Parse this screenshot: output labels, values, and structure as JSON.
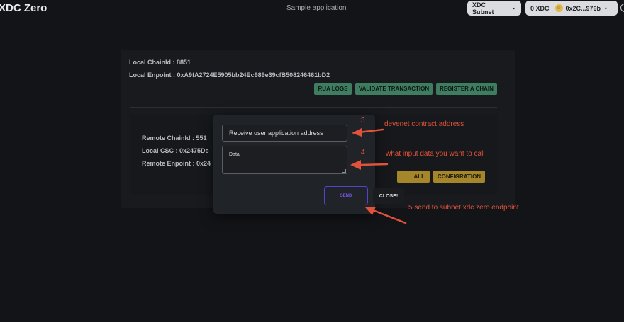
{
  "header": {
    "brand": "XDC Zero",
    "app_title": "Sample application",
    "network_button": "XDC Subnet",
    "balance": "0 XDC",
    "wallet_address": "0x2C...976b"
  },
  "local": {
    "chain_id": "Local ChainId : 8851",
    "endpoint": "Local Enpoint : 0xA9fA2724E5905bb24Ec989e39cfB508246461bD2"
  },
  "actions": {
    "rua_logs": "RUA LOGS",
    "validate": "VALIDATE TRANSACTION",
    "register": "REGISTER A CHAIN"
  },
  "remote": {
    "chain_id": "Remote ChainId : 551",
    "local_csc": "Local CSC : 0x2475Dc",
    "endpoint": "Remote Enpoint : 0x24",
    "call_fragment": "ALL",
    "configuration": "CONFIGRATION"
  },
  "modal": {
    "receiver_placeholder": "Receive user application address",
    "data_placeholder": "Data",
    "send": "SEND",
    "close": "CLOSE!"
  },
  "annotations": {
    "n3": "3",
    "n3_text": "devenet contract address",
    "n4": "4",
    "n4_text": "what input data you want to call",
    "n5_text": "5 send to subnet xdc zero endpoint"
  },
  "colors": {
    "annotation": "#e0523a",
    "accent_green": "#3e7d5f",
    "accent_gold": "#a6862a",
    "send_purple": "#5b3fd1"
  }
}
